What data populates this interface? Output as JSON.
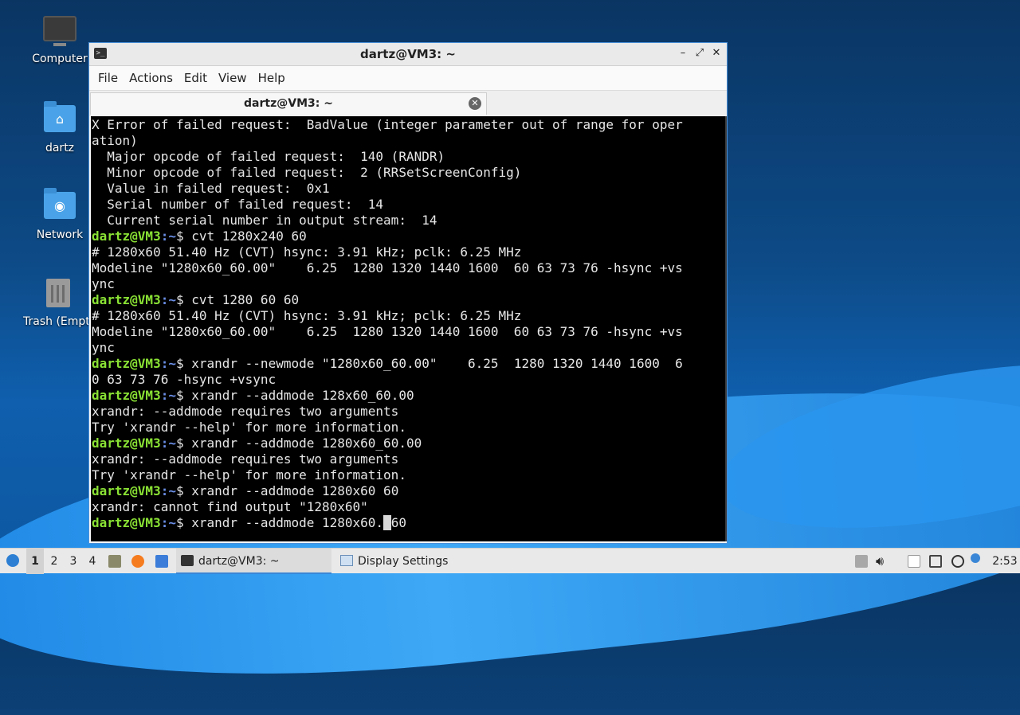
{
  "desktop": {
    "icons": [
      {
        "label": "Computer",
        "icon": "computer-icon"
      },
      {
        "label": "dartz",
        "icon": "home-folder-icon"
      },
      {
        "label": "Network",
        "icon": "network-folder-icon"
      },
      {
        "label": "Trash (Empt",
        "icon": "trash-icon"
      }
    ]
  },
  "window": {
    "title": "dartz@VM3: ~",
    "controls": {
      "minimize": "–",
      "maximize": "⤢",
      "close": "✕"
    },
    "menu": [
      "File",
      "Actions",
      "Edit",
      "View",
      "Help"
    ],
    "tab": {
      "label": "dartz@VM3: ~",
      "close": "✕"
    }
  },
  "terminal": {
    "prompt_user": "dartz@VM3",
    "prompt_dir": ":~",
    "prompt_sym": "$ ",
    "lines": [
      {
        "t": "out",
        "text": "X Error of failed request:  BadValue (integer parameter out of range for oper"
      },
      {
        "t": "out",
        "text": "ation)"
      },
      {
        "t": "out",
        "text": "  Major opcode of failed request:  140 (RANDR)"
      },
      {
        "t": "out",
        "text": "  Minor opcode of failed request:  2 (RRSetScreenConfig)"
      },
      {
        "t": "out",
        "text": "  Value in failed request:  0x1"
      },
      {
        "t": "out",
        "text": "  Serial number of failed request:  14"
      },
      {
        "t": "out",
        "text": "  Current serial number in output stream:  14"
      },
      {
        "t": "cmd",
        "text": "cvt 1280x240 60"
      },
      {
        "t": "out",
        "text": "# 1280x60 51.40 Hz (CVT) hsync: 3.91 kHz; pclk: 6.25 MHz"
      },
      {
        "t": "out",
        "text": "Modeline \"1280x60_60.00\"    6.25  1280 1320 1440 1600  60 63 73 76 -hsync +vs"
      },
      {
        "t": "out",
        "text": "ync"
      },
      {
        "t": "cmd",
        "text": "cvt 1280 60 60"
      },
      {
        "t": "out",
        "text": "# 1280x60 51.40 Hz (CVT) hsync: 3.91 kHz; pclk: 6.25 MHz"
      },
      {
        "t": "out",
        "text": "Modeline \"1280x60_60.00\"    6.25  1280 1320 1440 1600  60 63 73 76 -hsync +vs"
      },
      {
        "t": "out",
        "text": "ync"
      },
      {
        "t": "cmd",
        "text": "xrandr --newmode \"1280x60_60.00\"    6.25  1280 1320 1440 1600  6"
      },
      {
        "t": "out",
        "text": "0 63 73 76 -hsync +vsync"
      },
      {
        "t": "cmd",
        "text": "xrandr --addmode 128x60_60.00"
      },
      {
        "t": "out",
        "text": "xrandr: --addmode requires two arguments"
      },
      {
        "t": "out",
        "text": "Try 'xrandr --help' for more information."
      },
      {
        "t": "cmd",
        "text": "xrandr --addmode 1280x60_60.00"
      },
      {
        "t": "out",
        "text": "xrandr: --addmode requires two arguments"
      },
      {
        "t": "out",
        "text": "Try 'xrandr --help' for more information."
      },
      {
        "t": "cmd",
        "text": "xrandr --addmode 1280x60 60"
      },
      {
        "t": "out",
        "text": "xrandr: cannot find output \"1280x60\""
      },
      {
        "t": "cur",
        "before": "xrandr --addmode 1280x60.",
        "cursor": "_",
        "after": "60"
      }
    ]
  },
  "taskbar": {
    "workspaces": [
      "1",
      "2",
      "3",
      "4"
    ],
    "active_workspace": "1",
    "tasks": [
      {
        "label": "dartz@VM3: ~",
        "icon": "terminal-icon",
        "active": true
      },
      {
        "label": "Display Settings",
        "icon": "display-icon",
        "active": false
      }
    ],
    "clock": "2:53",
    "colors": {
      "accent": "#3a86d6",
      "prompt_user": "#8ae234",
      "prompt_dir": "#6b8fe6"
    }
  }
}
